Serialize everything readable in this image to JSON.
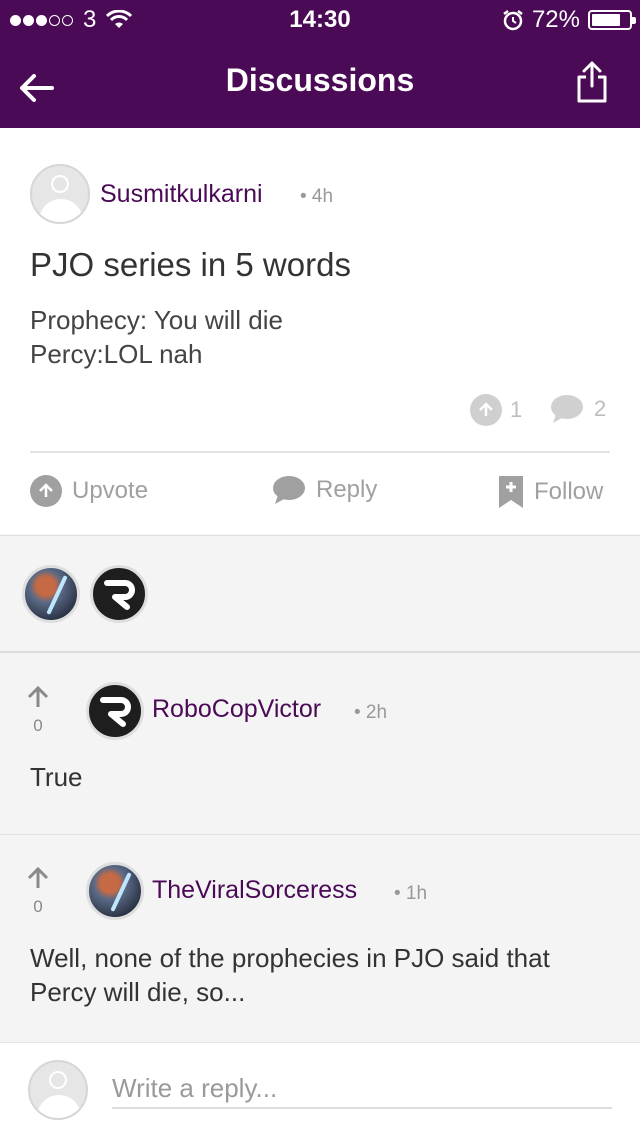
{
  "status_bar": {
    "carrier": "3",
    "time": "14:30",
    "battery": "72%",
    "battery_level": 0.72
  },
  "nav": {
    "title": "Discussions",
    "back_icon": "arrow-left-icon",
    "share_icon": "share-icon"
  },
  "post": {
    "author": "Susmitkulkarni",
    "time": "• 4h",
    "title": "PJO series in 5 words",
    "body_line1": "Prophecy: You will die",
    "body_line2": "Percy:LOL nah",
    "upvote_count": "1",
    "reply_count": "2"
  },
  "actions": {
    "upvote": "Upvote",
    "reply": "Reply",
    "follow": "Follow"
  },
  "comments": [
    {
      "author": "RoboCopVictor",
      "time": "• 2h",
      "votes": "0",
      "text": "True"
    },
    {
      "author": "TheViralSorceress",
      "time": "• 1h",
      "votes": "0",
      "text_line1": "Well, none of the prophecies in PJO said that",
      "text_line2": "Percy will die, so..."
    }
  ],
  "composer": {
    "placeholder": "Write a reply..."
  },
  "colors": {
    "brand": "#4a0a56",
    "author": "#4a0a56"
  }
}
